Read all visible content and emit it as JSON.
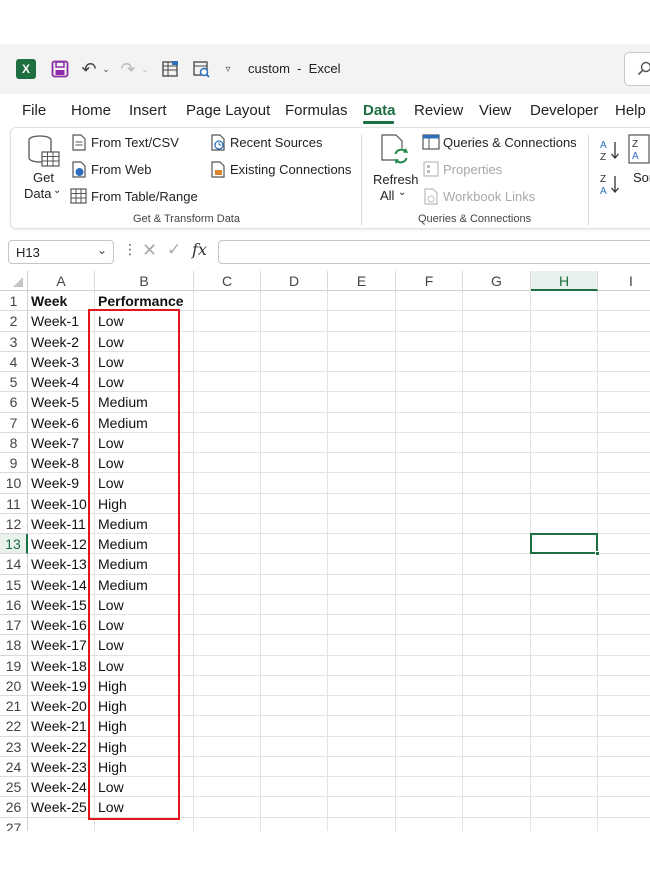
{
  "window": {
    "document_title": "custom  -  Excel",
    "app_badge": "X"
  },
  "quick_access": {
    "icons": [
      "excel-logo",
      "save-icon",
      "undo-icon",
      "redo-icon",
      "form-icon",
      "custom-views-icon",
      "customize-qat-icon"
    ]
  },
  "menu": {
    "tabs": [
      "File",
      "Home",
      "Insert",
      "Page Layout",
      "Formulas",
      "Data",
      "Review",
      "View",
      "Developer",
      "Help"
    ],
    "active": "Data"
  },
  "ribbon": {
    "get_transform": {
      "get_data_label_1": "Get",
      "get_data_label_2": "Data",
      "from_text_csv": "From Text/CSV",
      "from_web": "From Web",
      "from_table_range": "From Table/Range",
      "recent_sources": "Recent Sources",
      "existing_connections": "Existing Connections",
      "group_label": "Get & Transform Data"
    },
    "queries": {
      "refresh_label_1": "Refresh",
      "refresh_label_2": "All",
      "queries_connections": "Queries & Connections",
      "properties": "Properties",
      "workbook_links": "Workbook Links",
      "group_label": "Queries & Connections"
    },
    "sort": {
      "sort_label": "Sor"
    }
  },
  "formula_bar": {
    "name_box": "H13",
    "fx": "fx",
    "formula": ""
  },
  "sheet": {
    "columns": [
      "A",
      "B",
      "C",
      "D",
      "E",
      "F",
      "G",
      "H",
      "I"
    ],
    "selected_column": "H",
    "selected_row": 13,
    "active_cell": "H13",
    "rows": [
      {
        "n": "1",
        "a": "Week",
        "b": "Performance"
      },
      {
        "n": "2",
        "a": "Week-1",
        "b": "Low"
      },
      {
        "n": "3",
        "a": "Week-2",
        "b": "Low"
      },
      {
        "n": "4",
        "a": "Week-3",
        "b": "Low"
      },
      {
        "n": "5",
        "a": "Week-4",
        "b": "Low"
      },
      {
        "n": "6",
        "a": "Week-5",
        "b": "Medium"
      },
      {
        "n": "7",
        "a": "Week-6",
        "b": "Medium"
      },
      {
        "n": "8",
        "a": "Week-7",
        "b": "Low"
      },
      {
        "n": "9",
        "a": "Week-8",
        "b": "Low"
      },
      {
        "n": "10",
        "a": "Week-9",
        "b": "Low"
      },
      {
        "n": "11",
        "a": "Week-10",
        "b": "High"
      },
      {
        "n": "12",
        "a": "Week-11",
        "b": "Medium"
      },
      {
        "n": "13",
        "a": "Week-12",
        "b": "Medium"
      },
      {
        "n": "14",
        "a": "Week-13",
        "b": "Medium"
      },
      {
        "n": "15",
        "a": "Week-14",
        "b": "Medium"
      },
      {
        "n": "16",
        "a": "Week-15",
        "b": "Low"
      },
      {
        "n": "17",
        "a": "Week-16",
        "b": "Low"
      },
      {
        "n": "18",
        "a": "Week-17",
        "b": "Low"
      },
      {
        "n": "19",
        "a": "Week-18",
        "b": "Low"
      },
      {
        "n": "20",
        "a": "Week-19",
        "b": "High"
      },
      {
        "n": "21",
        "a": "Week-20",
        "b": "High"
      },
      {
        "n": "22",
        "a": "Week-21",
        "b": "High"
      },
      {
        "n": "23",
        "a": "Week-22",
        "b": "High"
      },
      {
        "n": "24",
        "a": "Week-23",
        "b": "High"
      },
      {
        "n": "25",
        "a": "Week-24",
        "b": "Low"
      },
      {
        "n": "26",
        "a": "Week-25",
        "b": "Low"
      },
      {
        "n": "27",
        "a": "",
        "b": ""
      }
    ],
    "highlight_range": "B2:B26",
    "colors": {
      "accent": "#1d6f42",
      "highlight_border": "#e0181c"
    }
  }
}
